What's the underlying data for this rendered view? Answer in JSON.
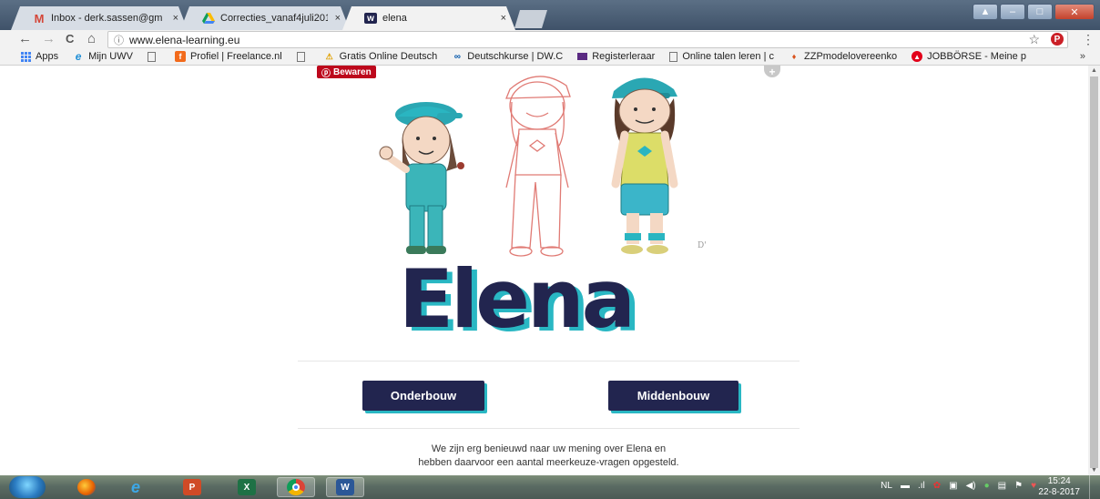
{
  "tabs": [
    {
      "title": "Inbox - derk.sassen@gm",
      "icon": "gmail-icon",
      "close": "×"
    },
    {
      "title": "Correcties_vanaf4juli201",
      "icon": "drive-icon",
      "close": "×"
    },
    {
      "title": "elena",
      "icon": "w-site-icon",
      "close": "×"
    }
  ],
  "toolbar": {
    "back": "←",
    "forward": "→",
    "reload": "C",
    "home": "⌂",
    "info": "ⓘ",
    "url": "www.elena-learning.eu",
    "star": "☆",
    "pinterest": "P",
    "menu": "⋮"
  },
  "bookmarks": [
    {
      "label": "Apps",
      "icon": "apps-grid-icon"
    },
    {
      "label": "Mijn UWV",
      "icon": "ie-icon"
    },
    {
      "label": "",
      "icon": "page-icon"
    },
    {
      "label": "Profiel | Freelance.nl",
      "icon": "freelance-icon"
    },
    {
      "label": "",
      "icon": "page-icon"
    },
    {
      "label": "Gratis Online Deutsch",
      "icon": "warning-icon"
    },
    {
      "label": "Deutschkurse | DW.C",
      "icon": "dw-icon"
    },
    {
      "label": "Registerleraar",
      "icon": "register-icon"
    },
    {
      "label": "Online talen leren | c",
      "icon": "page-icon"
    },
    {
      "label": "ZZPmodelovereenko",
      "icon": "zzp-icon"
    },
    {
      "label": "JOBBÖRSE - Meine p",
      "icon": "jobborse-icon"
    }
  ],
  "bookmarks_more": "»",
  "page": {
    "pin_save": "Bewaren",
    "logo": "Elena",
    "buttons": {
      "onderbouw": "Onderbouw",
      "middenbouw": "Middenbouw"
    },
    "intro_line1": "We zijn erg benieuwd naar uw mening over Elena en",
    "intro_line2": "hebben daarvoor een aantal meerkeuze-vragen opgesteld.",
    "colors": {
      "navy": "#22254f",
      "teal": "#29b7c3"
    }
  },
  "taskbar": {
    "apps": [
      {
        "name": "firefox",
        "label": ""
      },
      {
        "name": "internet-explorer",
        "label": "e"
      },
      {
        "name": "powerpoint",
        "label": "P"
      },
      {
        "name": "excel",
        "label": "X"
      },
      {
        "name": "chrome",
        "label": ""
      },
      {
        "name": "word",
        "label": "W"
      }
    ],
    "lang": "NL",
    "time": "15:24",
    "date": "22-8-2017"
  }
}
